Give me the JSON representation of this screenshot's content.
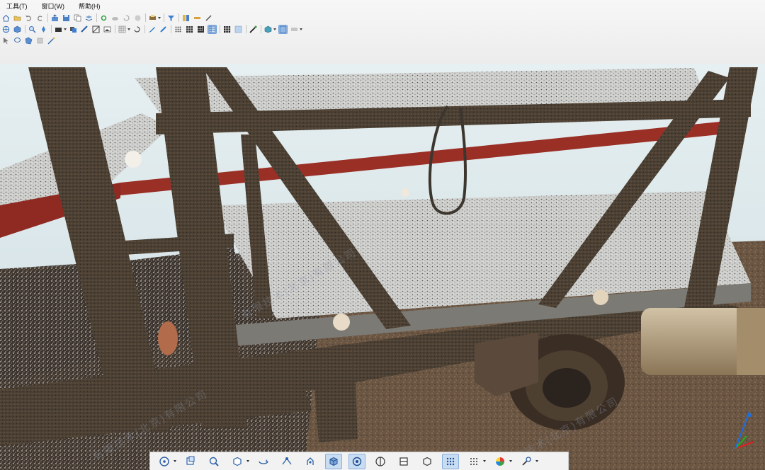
{
  "menu": {
    "items": [
      "工具(T)",
      "窗口(W)",
      "帮助(H)"
    ]
  },
  "toolbars": {
    "row1": [
      "home-icon",
      "open-icon",
      "undo-icon",
      "redo-icon",
      "export-icon",
      "save-icon",
      "copy-icon",
      "layers-icon",
      "settings-icon",
      "cloud-icon",
      "refresh-icon",
      "sphere-icon",
      "print-icon",
      "filter-icon",
      "grid-icon",
      "measure-icon",
      "pen-icon"
    ],
    "row2": [
      "globe-icon",
      "cube-icon",
      "zoom-icon",
      "pan-icon",
      "camera-icon",
      "layers-icon",
      "tool-icon",
      "slice-icon",
      "image-icon",
      "grid-icon",
      "rotate-icon",
      "edit-icon",
      "pencil-icon",
      "dots-icon",
      "grid-icon",
      "grid-icon",
      "grid-icon",
      "table-icon",
      "select-icon",
      "fill-icon",
      "paint-icon",
      "box-icon",
      "view-icon"
    ],
    "row3": [
      "pointer-icon",
      "lasso-icon",
      "polygon-icon",
      "clip-icon",
      "wand-icon"
    ]
  },
  "watermarks": [
    "有限技术(北京)有限公司",
    "有限技术(北京)有限公司",
    "有限技术(北京)有限公司"
  ],
  "bottom_toolbar": {
    "buttons": [
      "orbit-icon",
      "pan-icon",
      "zoom-icon",
      "cube-view-icon",
      "rotate-icon",
      "fly-icon",
      "walk-icon",
      "perspective-cube-icon",
      "sphere-view-icon",
      "split-icon",
      "section-icon",
      "isometric-icon",
      "points-icon",
      "point-size-icon",
      "color-mode-icon",
      "tools-icon"
    ],
    "active": [
      "perspective-cube-icon",
      "sphere-view-icon",
      "points-icon"
    ]
  },
  "axis": {
    "x": "x",
    "y": "y",
    "z": "z"
  }
}
